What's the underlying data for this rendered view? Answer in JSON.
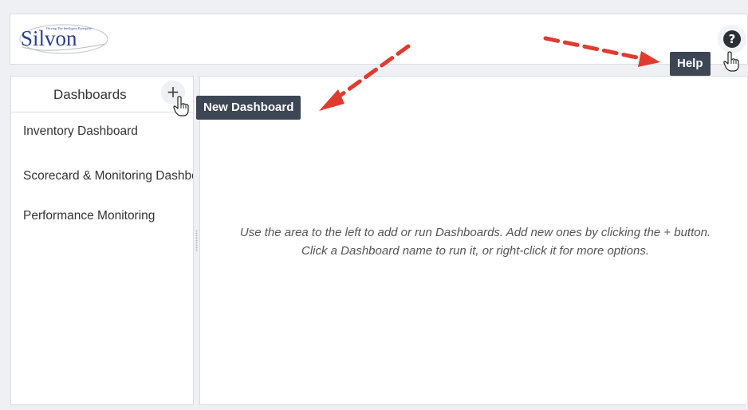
{
  "header": {
    "logo_text": "Silvon",
    "logo_tagline": "Driving The Intelligent Enterprise",
    "help_icon_glyph": "?",
    "help_tooltip": "Help"
  },
  "sidebar": {
    "title": "Dashboards",
    "add_glyph": "+",
    "add_tooltip": "New Dashboard",
    "items": [
      {
        "label": "Inventory Dashboard"
      },
      {
        "label": "Scorecard & Monitoring Dashboard"
      },
      {
        "label": "Performance Monitoring"
      }
    ]
  },
  "main": {
    "message_line1": "Use the area to the left to add or run Dashboards. Add new ones by clicking the + button.",
    "message_line2": "Click a Dashboard name to run it, or right-click it for more options."
  },
  "colors": {
    "tooltip_bg": "#3d4654",
    "arrow_red": "#e03b2f",
    "logo_blue": "#2b3f8c"
  }
}
